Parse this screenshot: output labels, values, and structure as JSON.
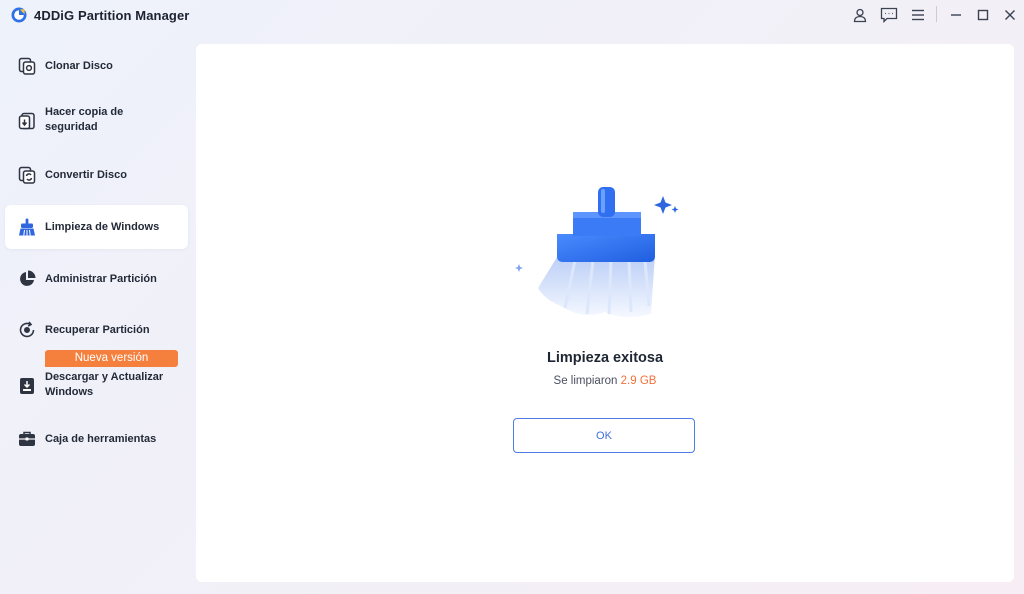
{
  "app": {
    "title": "4DDiG Partition Manager",
    "logo_icon": "4ddig-logo-icon"
  },
  "window_controls": [
    {
      "name": "account-icon"
    },
    {
      "name": "feedback-icon"
    },
    {
      "name": "menu-icon"
    },
    {
      "name": "minimize-icon"
    },
    {
      "name": "maximize-icon"
    },
    {
      "name": "close-icon"
    }
  ],
  "sidebar": {
    "items": [
      {
        "label": "Clonar Disco",
        "icon": "clone-disk-icon",
        "active": false
      },
      {
        "label": "Hacer copia de\nseguridad",
        "icon": "backup-icon",
        "active": false
      },
      {
        "label": "Convertir Disco",
        "icon": "convert-disk-icon",
        "active": false
      },
      {
        "label": "Limpieza de Windows",
        "icon": "broom-icon",
        "active": true
      },
      {
        "label": "Administrar Partición",
        "icon": "pie-chart-icon",
        "active": false
      },
      {
        "label": "Recuperar Partición",
        "icon": "recover-partition-icon",
        "active": false
      },
      {
        "label": "Descargar y Actualizar\nWindows",
        "icon": "download-windows-icon",
        "active": false,
        "badge": "Nueva versión"
      },
      {
        "label": "Caja de herramientas",
        "icon": "toolbox-icon",
        "active": false
      }
    ]
  },
  "result": {
    "title": "Limpieza exitosa",
    "subtitle_prefix": "Se limpiaron ",
    "amount": "2.9 GB",
    "ok_label": "OK",
    "illustration": "broom-illustration"
  },
  "colors": {
    "accent": "#3e6fe0",
    "highlight": "#f2713a",
    "badge": "#f5803e"
  }
}
